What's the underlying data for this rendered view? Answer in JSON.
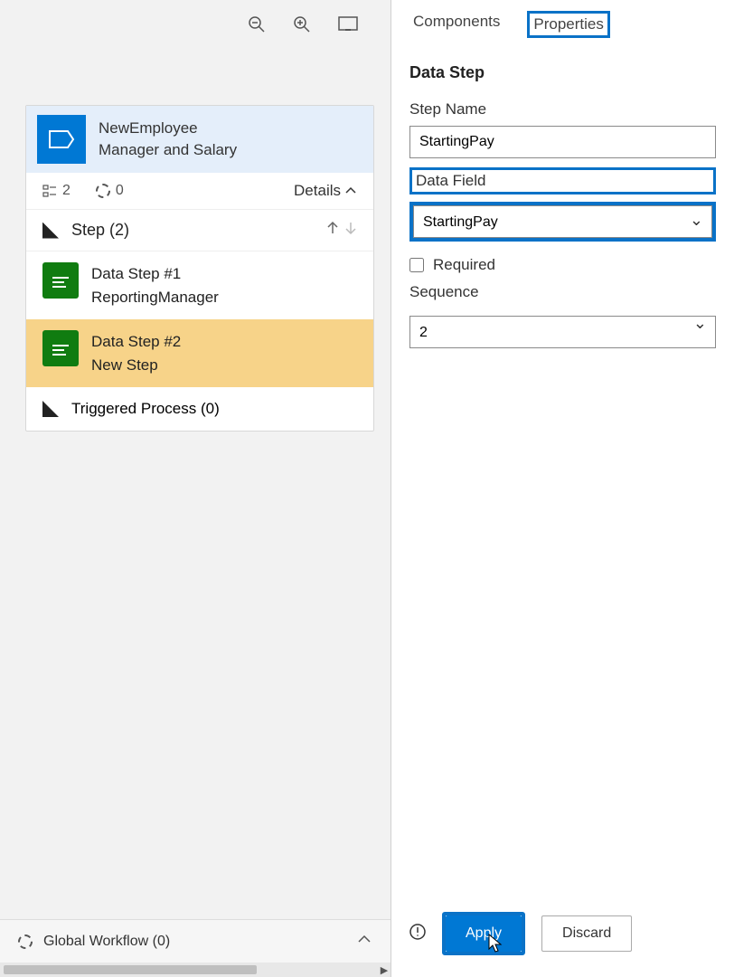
{
  "card": {
    "title1": "NewEmployee",
    "title2": "Manager and Salary",
    "meta_count1": "2",
    "meta_count2": "0",
    "details_label": "Details",
    "step_header": "Step (2)",
    "steps": [
      {
        "line1": "Data Step #1",
        "line2": "ReportingManager"
      },
      {
        "line1": "Data Step #2",
        "line2": "New Step"
      }
    ],
    "triggered_label": "Triggered Process (0)"
  },
  "footer": {
    "global_label": "Global Workflow (0)"
  },
  "tabs": {
    "components": "Components",
    "properties": "Properties"
  },
  "panel": {
    "section": "Data Step",
    "step_name_label": "Step Name",
    "step_name_value": "StartingPay",
    "data_field_label": "Data Field",
    "data_field_value": "StartingPay",
    "required_label": "Required",
    "sequence_label": "Sequence",
    "sequence_value": "2"
  },
  "actions": {
    "apply": "Apply",
    "discard": "Discard"
  }
}
